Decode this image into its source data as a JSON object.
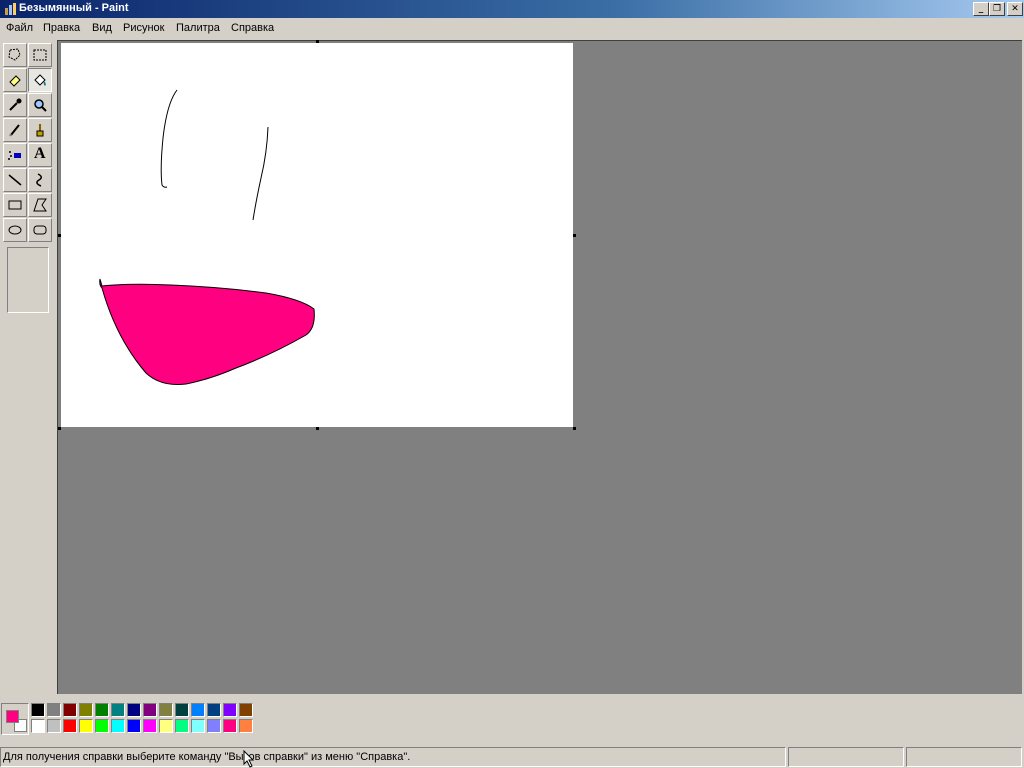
{
  "window": {
    "title": "Безымянный - Paint"
  },
  "menu": {
    "items": [
      "Файл",
      "Правка",
      "Вид",
      "Рисунок",
      "Палитра",
      "Справка"
    ]
  },
  "toolbox": {
    "tools": [
      {
        "name": "free-select-icon",
        "active": false
      },
      {
        "name": "rect-select-icon",
        "active": false
      },
      {
        "name": "eraser-icon",
        "active": false
      },
      {
        "name": "fill-bucket-icon",
        "active": true
      },
      {
        "name": "color-picker-icon",
        "active": false
      },
      {
        "name": "magnifier-icon",
        "active": false
      },
      {
        "name": "pencil-icon",
        "active": false
      },
      {
        "name": "brush-icon",
        "active": false
      },
      {
        "name": "airbrush-icon",
        "active": false
      },
      {
        "name": "text-icon",
        "active": false
      },
      {
        "name": "line-icon",
        "active": false
      },
      {
        "name": "curve-icon",
        "active": false
      },
      {
        "name": "rectangle-icon",
        "active": false
      },
      {
        "name": "polygon-icon",
        "active": false
      },
      {
        "name": "ellipse-icon",
        "active": false
      },
      {
        "name": "rounded-rect-icon",
        "active": false
      }
    ],
    "text_tool_glyph": "A"
  },
  "colors": {
    "foreground": "#ff0080",
    "background": "#ffffff",
    "drawing_fill": "#ff0080",
    "top_row": [
      "#000000",
      "#808080",
      "#800000",
      "#808000",
      "#008000",
      "#008080",
      "#000080",
      "#800080",
      "#808040",
      "#004040",
      "#0080ff",
      "#004080",
      "#8000ff",
      "#804000"
    ],
    "bottom_row": [
      "#ffffff",
      "#c0c0c0",
      "#ff0000",
      "#ffff00",
      "#00ff00",
      "#00ffff",
      "#0000ff",
      "#ff00ff",
      "#ffff80",
      "#00ff80",
      "#80ffff",
      "#8080ff",
      "#ff0080",
      "#ff8040"
    ]
  },
  "status": {
    "help_text": "Для получения справки выберите команду \"Вызов справки\" из меню \"Справка\"."
  }
}
